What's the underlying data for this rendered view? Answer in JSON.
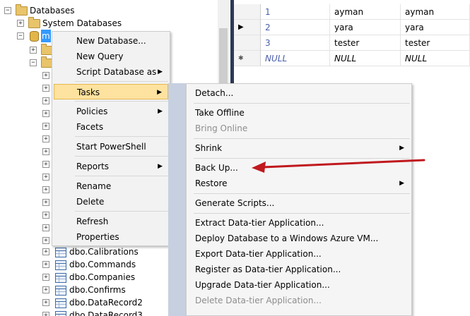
{
  "tree": {
    "root_label": "Databases",
    "system_db_label": "System Databases",
    "selected_db_label": "m",
    "tables": [
      "dbo.Calibrations",
      "dbo.Commands",
      "dbo.Companies",
      "dbo.Confirms",
      "dbo.DataRecord2",
      "dbo.DataRecord3"
    ]
  },
  "grid": {
    "rows": [
      {
        "marker": "",
        "num": "1",
        "col1": "ayman",
        "col2": "ayman"
      },
      {
        "marker": "▶",
        "num": "2",
        "col1": "yara",
        "col2": "yara"
      },
      {
        "marker": "",
        "num": "3",
        "col1": "tester",
        "col2": "tester"
      },
      {
        "marker": "✱",
        "num": "NULL",
        "col1": "NULL",
        "col2": "NULL"
      }
    ]
  },
  "context_menu": {
    "items": [
      {
        "label": "New Database...",
        "submenu": false
      },
      {
        "label": "New Query",
        "submenu": false
      },
      {
        "label": "Script Database as",
        "submenu": true
      },
      {
        "label": "Tasks",
        "submenu": true,
        "active": true
      },
      {
        "label": "Policies",
        "submenu": true
      },
      {
        "label": "Facets",
        "submenu": false
      },
      {
        "label": "Start PowerShell",
        "submenu": false
      },
      {
        "label": "Reports",
        "submenu": true
      },
      {
        "label": "Rename",
        "submenu": false
      },
      {
        "label": "Delete",
        "submenu": false
      },
      {
        "label": "Refresh",
        "submenu": false
      },
      {
        "label": "Properties",
        "submenu": false
      }
    ]
  },
  "tasks_menu": {
    "items": [
      {
        "label": "Detach...",
        "submenu": false,
        "disabled": false
      },
      {
        "label": "Take Offline",
        "submenu": false,
        "disabled": false
      },
      {
        "label": "Bring Online",
        "submenu": false,
        "disabled": true
      },
      {
        "label": "Shrink",
        "submenu": true,
        "disabled": false
      },
      {
        "label": "Back Up...",
        "submenu": false,
        "disabled": false
      },
      {
        "label": "Restore",
        "submenu": true,
        "disabled": false
      },
      {
        "label": "Generate Scripts...",
        "submenu": false,
        "disabled": false
      },
      {
        "label": "Extract Data-tier Application...",
        "submenu": false,
        "disabled": false
      },
      {
        "label": "Deploy Database to a Windows Azure VM...",
        "submenu": false,
        "disabled": false
      },
      {
        "label": "Export Data-tier Application...",
        "submenu": false,
        "disabled": false
      },
      {
        "label": "Register as Data-tier Application...",
        "submenu": false,
        "disabled": false
      },
      {
        "label": "Upgrade Data-tier Application...",
        "submenu": false,
        "disabled": false
      },
      {
        "label": "Delete Data-tier Application...",
        "submenu": false,
        "disabled": true
      }
    ]
  },
  "icons": {
    "submenu_arrow": "▶"
  },
  "colors": {
    "annotation_arrow": "#c0191e",
    "active_item_bg": "#fde2a0",
    "selection": "#3399ff"
  }
}
